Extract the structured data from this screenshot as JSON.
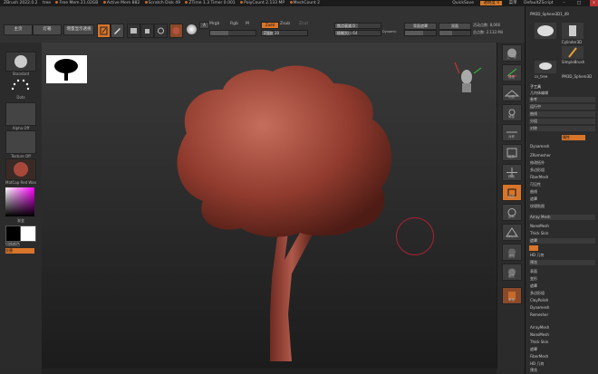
{
  "titlebar": {
    "items": [
      "ZBrush 2022.0.2",
      "tree",
      "Free Mem 21.02GB",
      "Active Mem 882",
      "Scratch Disk 49",
      "ZTime 1.3 Timer 0.001",
      "PolyCount 2.133 MP",
      "MeshCount 2"
    ],
    "right_items": [
      "QuickSave",
      "透明度 0",
      "菜单",
      "DefaultZScript"
    ],
    "quicksave_label": "QuickSave",
    "min": "–",
    "max": "□",
    "close": "×"
  },
  "toolbar": {
    "home_label": "主页",
    "light_label": "灯箱",
    "perspective_label": "增量显示透视",
    "edit_label": "Edit",
    "draw_label": "Draw",
    "move_label": "Move",
    "scale_label": "Scale",
    "rotate_label": "Rotate",
    "mrgb_label": "Mrgb",
    "rgb_label": "Rgb",
    "m_label": "M",
    "zadd_label": "Zadd",
    "zsub_label": "Zsub",
    "zcut_label": "Zcut",
    "z_intensity": "Z强度 20",
    "focal_shift": "焦点衰减 0",
    "draw_size": "绘制大小 64",
    "dynamic_label": "Dynamic",
    "backface": "背面遮罩",
    "double": "双面",
    "active_points": "活动点数: 8,066",
    "total_points": "总点数: 2.133 Mil"
  },
  "leftpanel": {
    "brush_label": "Standard",
    "stroke_label": "Dots",
    "alpha_label": "Alpha Off",
    "texture_label": "Texture Off",
    "material_label": "MatCap Red Wax",
    "gradient_label": "渐变",
    "switch_color_label": "切换颜色",
    "alternate_label": "交替"
  },
  "rightshelf": {
    "items": [
      "上一帧",
      "透视",
      "地面",
      "局部",
      "对称",
      "框架",
      "移动",
      "缩放",
      "旋转",
      "Poly F",
      "透明",
      "幽灵",
      "单独"
    ]
  },
  "rightpanel": {
    "tool_header": "PM3D_Sphere3D1_49",
    "tool_items": [
      "PM3D_Sphere3D1",
      "Cylinder3D",
      "SimpleBrush",
      "cs_tree",
      "PM3D_Sphere3D"
    ],
    "subtool_header": "子工具",
    "items": [
      "几何体编辑",
      "参考",
      "运行中",
      "曲线",
      "分组",
      "对称",
      "属性",
      "Dynamesh",
      "ZRemesher",
      "修改拓扑",
      "多边形组",
      "FiberMesh",
      "可见性",
      "曲线",
      "遮罩",
      "纹理贴图",
      "Array Mesh",
      "NanoMesh",
      "Thick Skin",
      "遮罩",
      "FiberMesh",
      "HD 几何",
      "预览",
      "表面",
      "变形",
      "遮罩",
      "多边形组",
      "ClayPolish",
      "Dynamesh",
      "Remesher"
    ],
    "bottom_items": [
      "ArrayMesh",
      "NanoMesh",
      "Thick Skin",
      "遮罩",
      "FiberMesh",
      "HD 几何",
      "预览"
    ]
  },
  "accent_color": "#d8752a"
}
